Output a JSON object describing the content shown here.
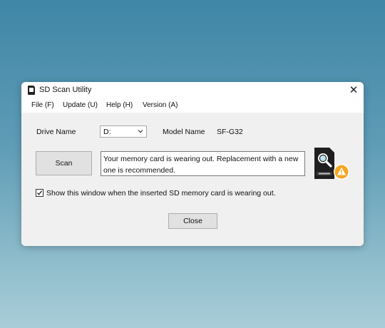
{
  "window": {
    "title": "SD Scan Utility",
    "close_glyph": "✕"
  },
  "menu": {
    "items": [
      {
        "label": "File (F)"
      },
      {
        "label": "Update (U)"
      },
      {
        "label": "Help (H)"
      },
      {
        "label": "Version (A)"
      }
    ]
  },
  "drive": {
    "label": "Drive Name",
    "value": "D:"
  },
  "model": {
    "label": "Model Name",
    "value": "SF-G32"
  },
  "scan": {
    "button_label": "Scan",
    "message": "Your memory card is wearing out. Replacement with a new one is recommended."
  },
  "option": {
    "checked": true,
    "label": "Show this window when the inserted SD memory card is wearing out."
  },
  "footer": {
    "close_label": "Close"
  },
  "icons": {
    "app": "sd-card-icon",
    "status": "sd-card-search-warning-icon"
  },
  "colors": {
    "warning": "#f5a623",
    "background_top": "#3f86a6",
    "background_bottom": "#a9cdd8"
  }
}
